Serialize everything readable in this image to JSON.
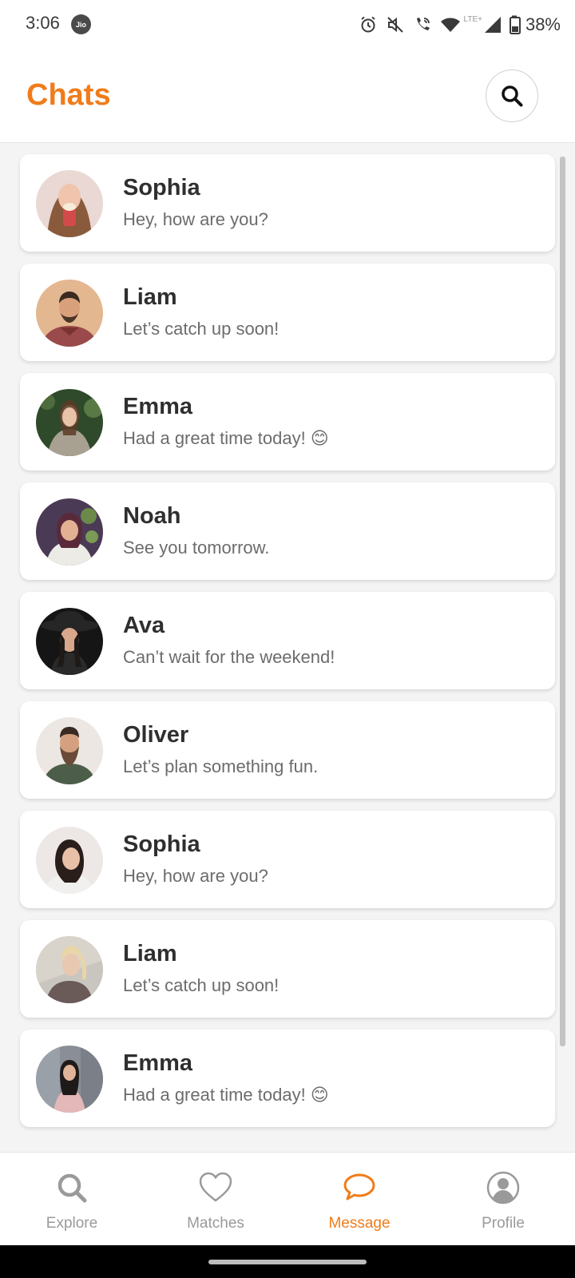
{
  "status_bar": {
    "time": "3:06",
    "carrier_badge": "Jio",
    "battery": "38%",
    "network_label": "LTE+",
    "icons": [
      "alarm-icon",
      "mute-icon",
      "wifi-call-icon",
      "wifi-icon",
      "signal-icon",
      "battery-icon"
    ]
  },
  "header": {
    "title": "Chats",
    "accent_color": "#f07c1a"
  },
  "chats": [
    {
      "name": "Sophia",
      "preview": "Hey, how are you?"
    },
    {
      "name": "Liam",
      "preview": "Let’s catch up soon!"
    },
    {
      "name": "Emma",
      "preview": "Had a great time today! 😊"
    },
    {
      "name": "Noah",
      "preview": "See you tomorrow."
    },
    {
      "name": "Ava",
      "preview": "Can’t wait for the weekend!"
    },
    {
      "name": "Oliver",
      "preview": "Let’s plan something fun."
    },
    {
      "name": "Sophia",
      "preview": "Hey, how are you?"
    },
    {
      "name": "Liam",
      "preview": "Let’s catch up soon!"
    },
    {
      "name": "Emma",
      "preview": "Had a great time today! 😊"
    }
  ],
  "bottom_nav": {
    "items": [
      {
        "label": "Explore",
        "icon": "search-icon",
        "active": false
      },
      {
        "label": "Matches",
        "icon": "heart-icon",
        "active": false
      },
      {
        "label": "Message",
        "icon": "chat-bubble-icon",
        "active": true
      },
      {
        "label": "Profile",
        "icon": "user-icon",
        "active": false
      }
    ]
  }
}
